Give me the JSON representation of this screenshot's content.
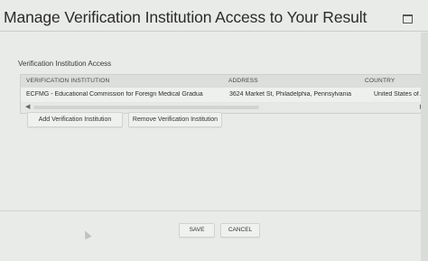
{
  "dialog": {
    "title": "Manage Verification Institution Access to Your Result"
  },
  "section": {
    "label": "Verification Institution Access"
  },
  "table": {
    "columns": [
      "VERIFICATION INSTITUTION",
      "ADDRESS",
      "COUNTRY"
    ],
    "rows": [
      {
        "institution": "ECFMG - Educational Commission for Foreign Medical Gradua",
        "address": "3624 Market St, Philadelphia, Pennsylvania",
        "country": "United States of Am"
      }
    ]
  },
  "actions": {
    "add_label": "Add Verification Institution",
    "remove_label": "Remove Verification Institution"
  },
  "footer": {
    "save_label": "SAVE",
    "cancel_label": "CANCEL"
  },
  "icons": {
    "maximize": "maximize-icon",
    "close": "close-icon",
    "scroll_left": "chevron-left-icon",
    "scroll_right": "chevron-right-icon"
  }
}
